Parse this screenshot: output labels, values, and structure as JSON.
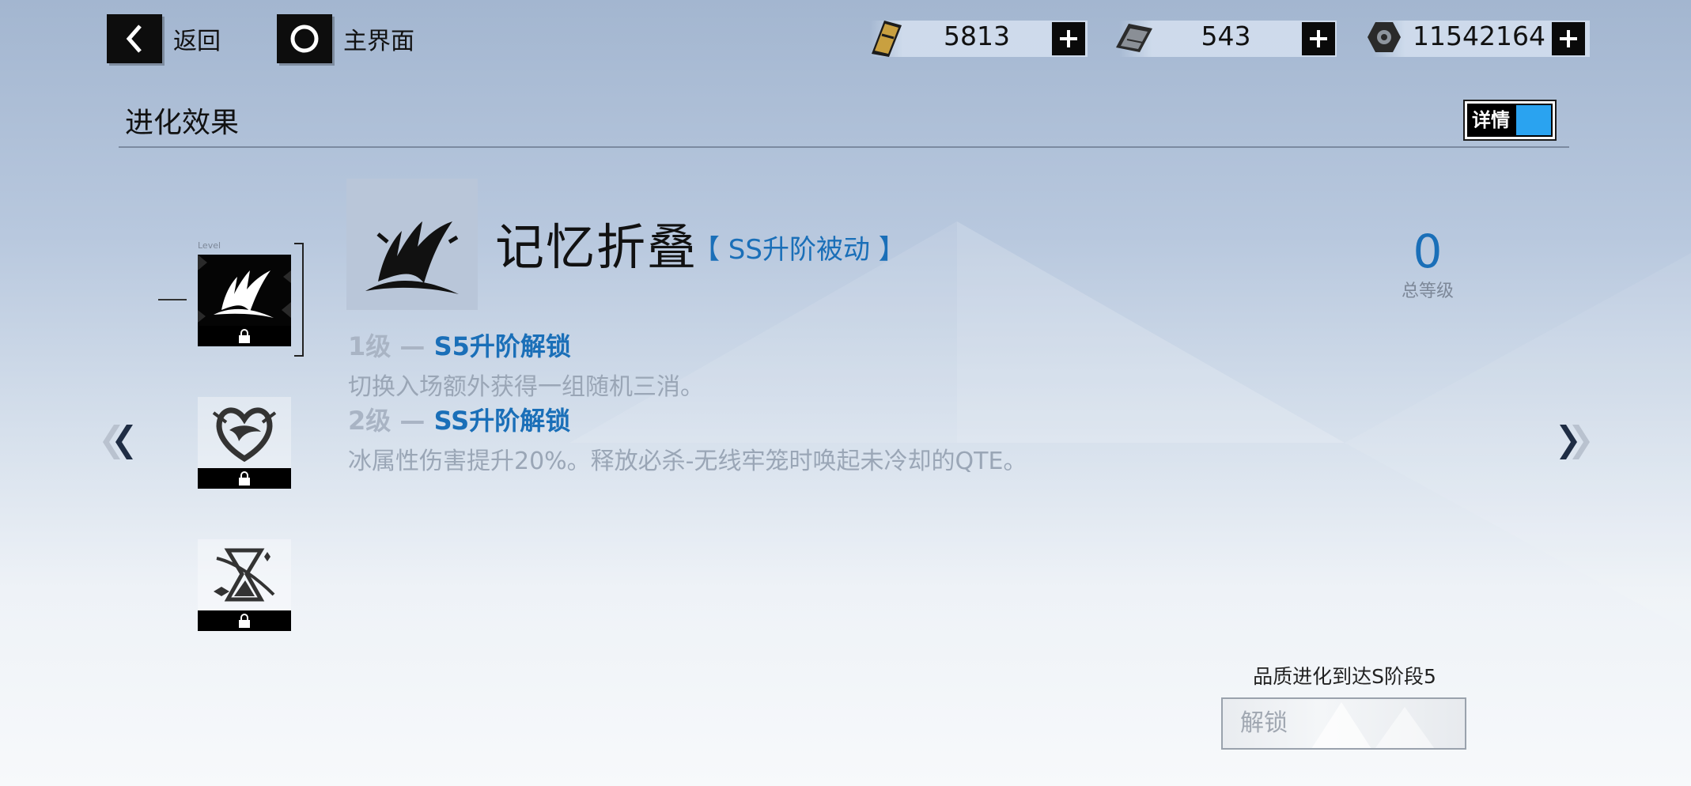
{
  "topbar": {
    "back_label": "返回",
    "home_label": "主界面"
  },
  "resources": [
    {
      "name": "ticket-icon",
      "value": "5813"
    },
    {
      "name": "card-icon",
      "value": "543"
    },
    {
      "name": "nut-icon",
      "value": "11542164"
    }
  ],
  "section": {
    "title": "进化效果",
    "detail_toggle_label": "详情"
  },
  "skill": {
    "name": "记忆折叠",
    "tag": "【 SS升阶被动 】",
    "levels": [
      {
        "num": "1级 — ",
        "unlock": "S5升阶解锁",
        "desc": "切换入场额外获得一组随机三消。"
      },
      {
        "num": "2级 — ",
        "unlock": "SS升阶解锁",
        "desc": "冰属性伤害提升20%。释放必杀-无线牢笼时唤起未冷却的QTE。"
      }
    ]
  },
  "total": {
    "value": "0",
    "label": "总等级"
  },
  "thumbs": [
    {
      "icon": "claw-slash-icon",
      "selected": true,
      "level_label": "Level"
    },
    {
      "icon": "heart-wing-icon",
      "selected": false
    },
    {
      "icon": "hourglass-icon",
      "selected": false
    }
  ],
  "unlock": {
    "condition": "品质进化到达S阶段5",
    "button_label": "解锁"
  },
  "colors": {
    "accent_blue": "#1a6fb8",
    "toggle_blue": "#2aa3f0"
  }
}
